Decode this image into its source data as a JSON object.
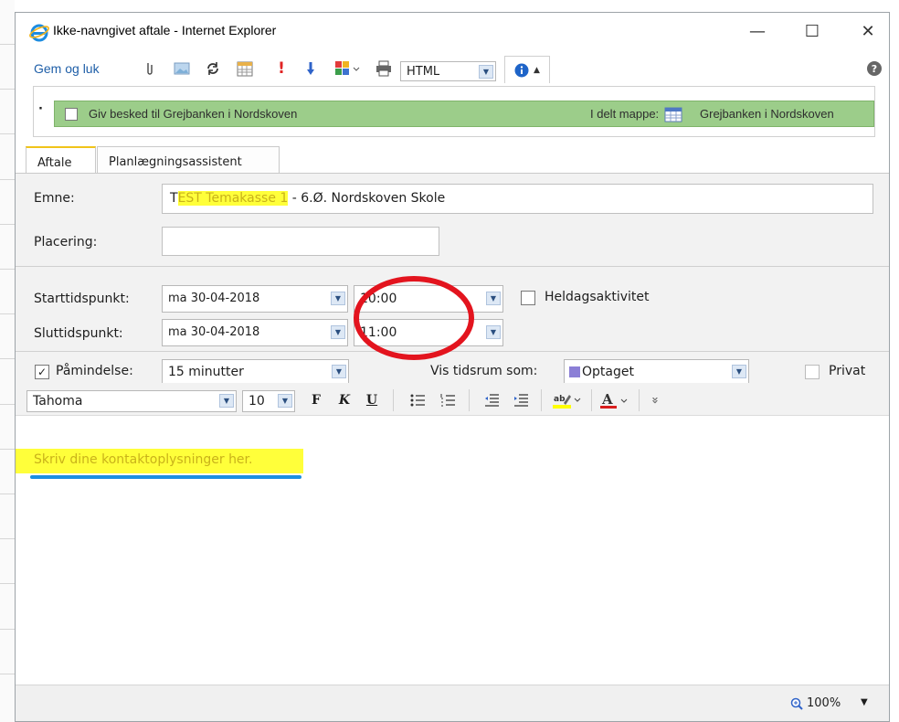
{
  "window": {
    "title": "Ikke-navngivet aftale - Internet Explorer",
    "minimize": "—",
    "maximize": "☐",
    "close": "✕"
  },
  "toolbar": {
    "save_close": "Gem og luk",
    "format_value": "HTML",
    "help": "?"
  },
  "infobar": {
    "notify_label": "Giv besked til Grejbanken i Nordskoven",
    "shared_prefix": "I delt mappe:",
    "shared_folder": "Grejbanken i Nordskoven",
    "dot": "·"
  },
  "tabs": [
    {
      "label": "Aftale"
    },
    {
      "label": "Planlægningsassistent"
    }
  ],
  "form": {
    "subject_label": "Emne:",
    "subject_first": "T",
    "subject_highlight": "EST Temakasse 1",
    "subject_rest": " - 6.Ø. Nordskoven Skole",
    "location_label": "Placering:",
    "location_value": "",
    "start_label": "Starttidspunkt:",
    "start_date": "ma 30-04-2018",
    "start_time": "10:00",
    "allday_label": "Heldagsaktivitet",
    "end_label": "Sluttidspunkt:",
    "end_date": "ma 30-04-2018",
    "end_time": "11:00",
    "reminder_label": "Påmindelse:",
    "reminder_value": "15 minutter",
    "show_as_label": "Vis tidsrum som:",
    "show_as_value": "Optaget",
    "private_label": "Privat"
  },
  "format": {
    "font": "Tahoma",
    "size": "10",
    "bold": "F",
    "italic": "K",
    "underline": "U",
    "more": "»"
  },
  "editor": {
    "placeholder": "Skriv dine kontaktoplysninger her."
  },
  "status": {
    "zoom": "100%"
  },
  "colors": {
    "highlight": "#ffff3a",
    "annotation_red": "#e3141e",
    "annotation_blue": "#1b8fe0",
    "infobar_green": "#9ccd8a",
    "busy_purple": "#8b7fd6"
  }
}
